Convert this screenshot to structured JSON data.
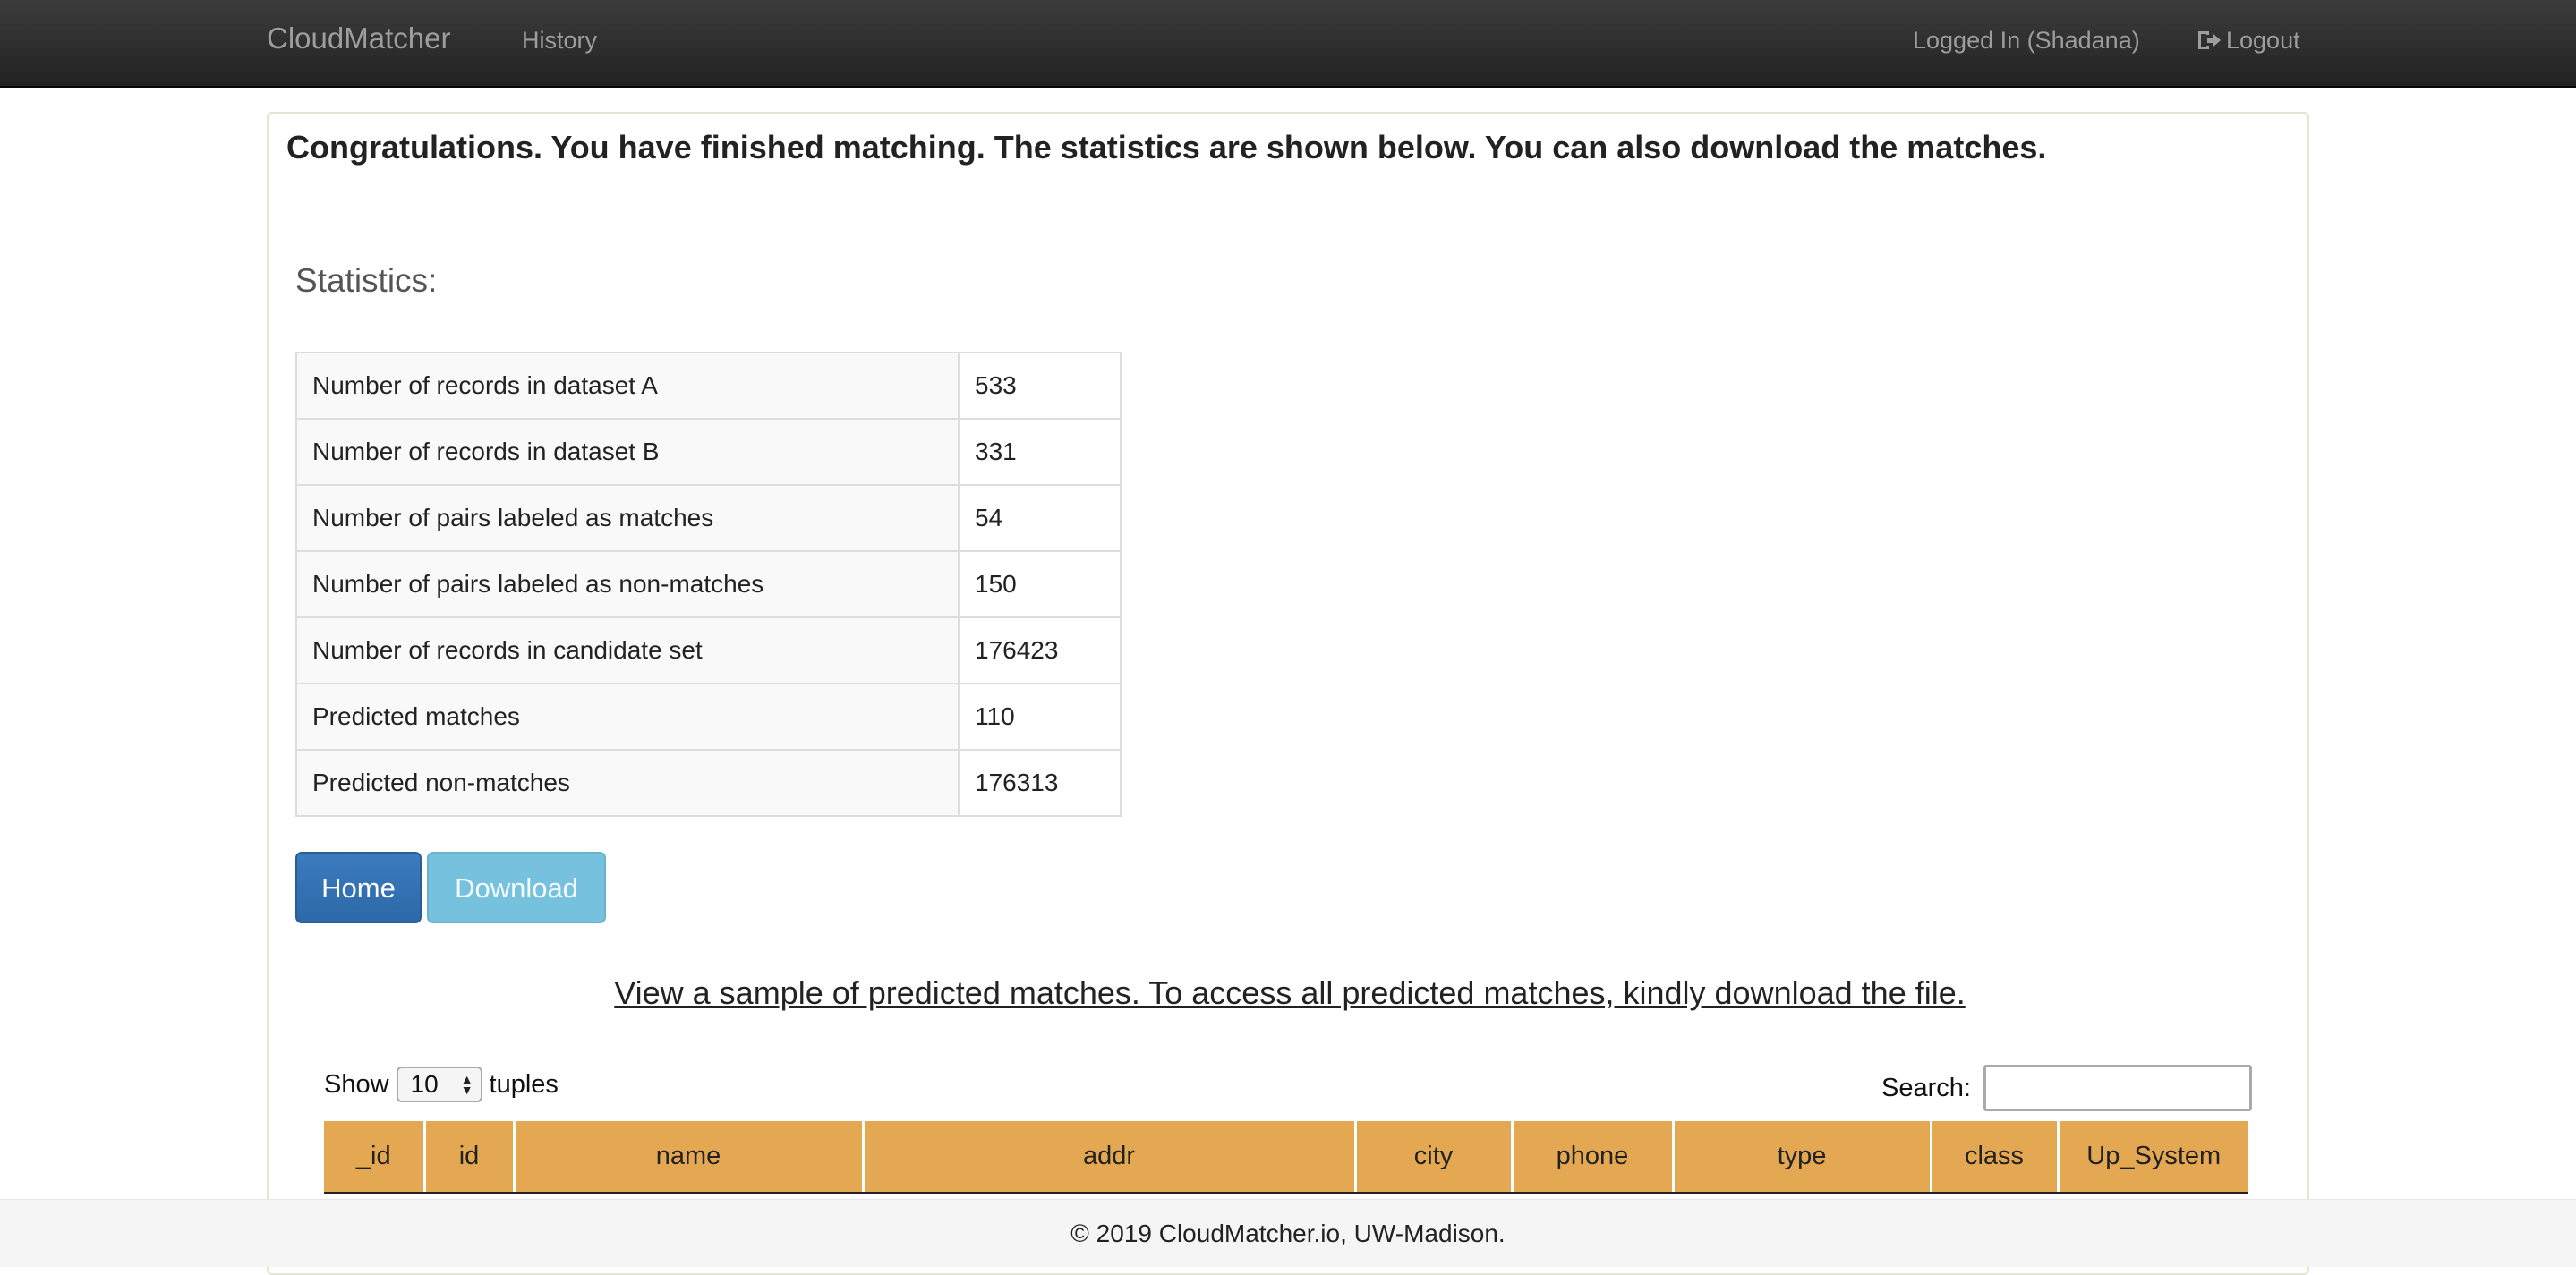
{
  "navbar": {
    "brand": "CloudMatcher",
    "history_label": "History",
    "logged_in_label": "Logged In (Shadana)",
    "logout_label": "Logout",
    "logout_icon": "logout-icon"
  },
  "main": {
    "congrats_text": "Congratulations. You have finished matching. The statistics are shown below. You can also download the matches.",
    "statistics_heading": "Statistics:",
    "stats": [
      {
        "label": "Number of records in dataset A",
        "value": "533"
      },
      {
        "label": "Number of records in dataset B",
        "value": "331"
      },
      {
        "label": "Number of pairs labeled as matches",
        "value": "54"
      },
      {
        "label": "Number of pairs labeled as non-matches",
        "value": "150"
      },
      {
        "label": "Number of records in candidate set",
        "value": "176423"
      },
      {
        "label": "Predicted matches",
        "value": "110"
      },
      {
        "label": "Predicted non-matches",
        "value": "176313"
      }
    ],
    "home_button": "Home",
    "download_button": "Download",
    "sample_link": "View a sample of predicted matches. To access all predicted matches, kindly download the file."
  },
  "table_controls": {
    "show_label": "Show",
    "show_value": "10",
    "tuples_label": "tuples",
    "search_label": "Search:",
    "search_value": ""
  },
  "data_table": {
    "columns": [
      "_id",
      "id",
      "name",
      "addr",
      "city",
      "phone",
      "type",
      "class",
      "Up_System"
    ]
  },
  "footer": {
    "text": "© 2019 CloudMatcher.io, UW-Madison."
  },
  "colors": {
    "navbar_bg": "#222222",
    "table_header_bg": "#e5a852",
    "home_button_bg": "#337ab7",
    "download_button_bg": "#76c1dd"
  }
}
